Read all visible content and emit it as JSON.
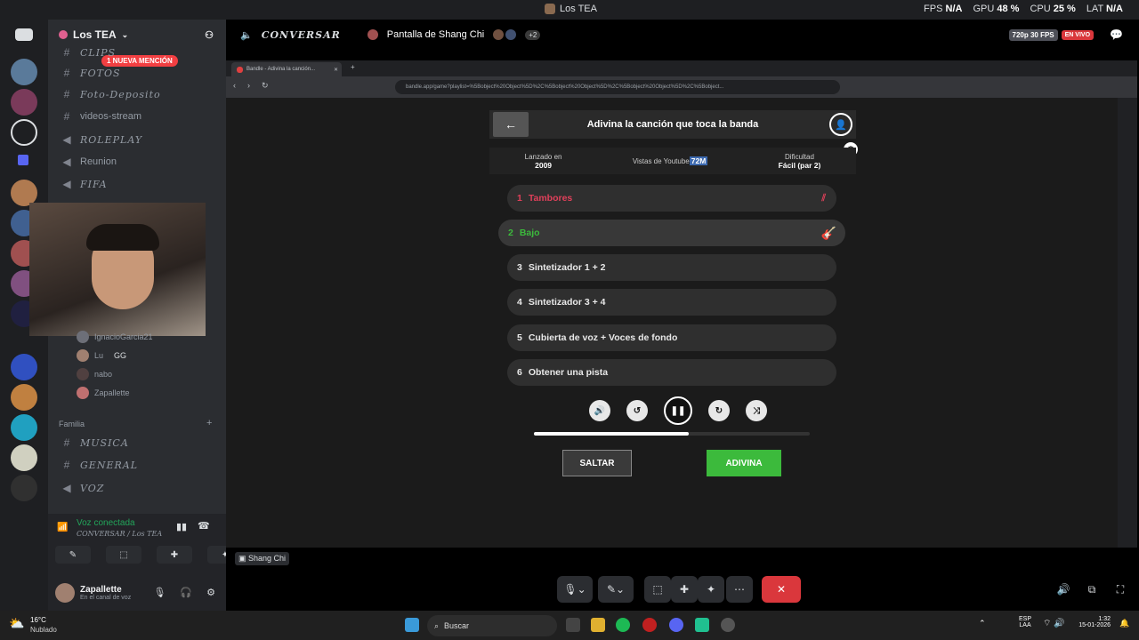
{
  "window_title": "Los TEA",
  "perf": {
    "fps_label": "FPS",
    "fps": "N/A",
    "gpu_label": "GPU",
    "gpu": "48 %",
    "cpu_label": "CPU",
    "cpu": "25 %",
    "lat_label": "LAT",
    "lat": "N/A"
  },
  "guild": {
    "name": "Los TEA",
    "mention_badge": "1 NUEVA MENCIÓN"
  },
  "channels": [
    {
      "name": "CLIPS",
      "type": "text"
    },
    {
      "name": "FOTOS",
      "type": "text"
    },
    {
      "name": "Foto-Deposito",
      "type": "text"
    },
    {
      "name": "videos-stream",
      "type": "text"
    },
    {
      "name": "ROLEPLAY",
      "type": "voice"
    },
    {
      "name": "Reunion",
      "type": "voice"
    },
    {
      "name": "FIFA",
      "type": "voice"
    }
  ],
  "voice_users": [
    {
      "name": "IgnacioGarcia21"
    },
    {
      "name": "Lu",
      "tag": "GG"
    },
    {
      "name": "nabo"
    },
    {
      "name": "Zapallette"
    }
  ],
  "category": "Familia",
  "family_channels": [
    {
      "name": "MUSICA",
      "type": "text"
    },
    {
      "name": "GENERAL",
      "type": "text"
    },
    {
      "name": "VOZ",
      "type": "voice"
    }
  ],
  "voice_status": {
    "title": "Voz conectada",
    "channel": "CONVERSAR / Los TEA"
  },
  "user": {
    "name": "Zapallette",
    "status": "En el canal de voz"
  },
  "stream_header": {
    "channel": "CONVERSAR",
    "screen": "Pantalla de Shang Chi",
    "extra_count": "+2",
    "quality": "720p 30 FPS",
    "live": "EN VIVO"
  },
  "browser": {
    "tab_title": "Bandle - Adivina la canción...",
    "url": "bandle.app/game?playlist=%5Bobject%20Object%5D%2C%5Bobject%20Object%5D%2C%5Bobject%20Object%5D%2C%5Bobject..."
  },
  "game": {
    "title": "Adivina la canción que toca la banda",
    "released_label": "Lanzado en",
    "released": "2009",
    "views_label": "Vistas de Youtube",
    "views": "72M",
    "difficulty_label": "Dificultad",
    "difficulty": "Fácil (par 2)",
    "tracks": [
      {
        "num": "1",
        "label": "Tambores"
      },
      {
        "num": "2",
        "label": "Bajo"
      },
      {
        "num": "3",
        "label": "Sintetizador 1 + 2"
      },
      {
        "num": "4",
        "label": "Sintetizador 3 + 4"
      },
      {
        "num": "5",
        "label": "Cubierta de voz + Voces de fondo"
      },
      {
        "num": "6",
        "label": "Obtener una pista"
      }
    ],
    "progress": 0.56,
    "skip": "SALTAR",
    "guess": "ADIVINA"
  },
  "streamer_tag": "Shang Chi",
  "taskbar": {
    "weather_temp": "16°C",
    "weather_desc": "Nublado",
    "search": "Buscar",
    "lang": "ESP",
    "lang2": "LAA",
    "time": "1:32",
    "date": "15-01-2026"
  },
  "colors": {
    "discord_bg": "#1e1f22",
    "sidebar": "#2b2d31",
    "accent_red": "#f23f42",
    "guess_green": "#3cba3c",
    "drum_red": "#e0405a",
    "voice_green": "#23a55a"
  }
}
